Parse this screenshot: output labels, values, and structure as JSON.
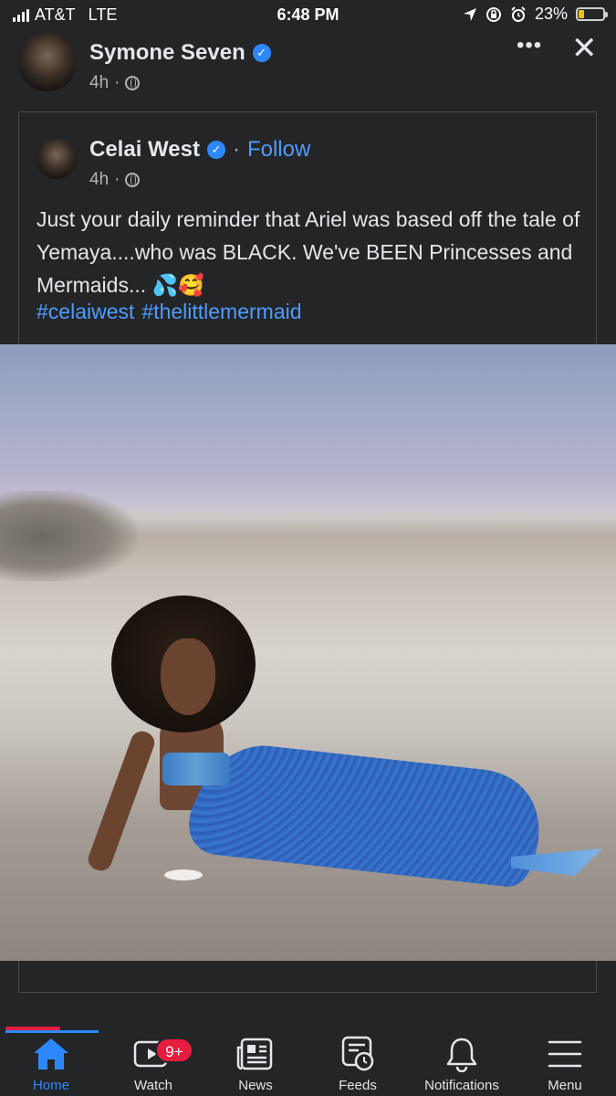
{
  "status_bar": {
    "carrier": "AT&T",
    "network": "LTE",
    "time": "6:48 PM",
    "battery": "23%",
    "battery_level": 0.23,
    "battery_color": "#f4c20d"
  },
  "post": {
    "author": "Symone Seven",
    "time": "4h",
    "more_label": "•••",
    "close_label": "✕"
  },
  "shared_post": {
    "author": "Celai West",
    "separator": "·",
    "follow_label": "Follow",
    "time": "4h",
    "text": "Just your daily reminder that Ariel was based off the tale of Yemaya....who was BLACK. We've BEEN Princesses and Mermaids... 💦🥰",
    "hashtags": [
      "#celaiwest",
      "#thelittlemermaid"
    ]
  },
  "tab_bar": {
    "items": [
      {
        "label": "Home",
        "icon": "home-icon",
        "active": true
      },
      {
        "label": "Watch",
        "icon": "watch-icon",
        "badge": "9+"
      },
      {
        "label": "News",
        "icon": "news-icon"
      },
      {
        "label": "Feeds",
        "icon": "feeds-icon"
      },
      {
        "label": "Notifications",
        "icon": "bell-icon"
      },
      {
        "label": "Menu",
        "icon": "menu-icon"
      }
    ]
  },
  "colors": {
    "background": "#242526",
    "accent": "#2d88ff",
    "link": "#4e9cff",
    "badge": "#e41e3f"
  }
}
